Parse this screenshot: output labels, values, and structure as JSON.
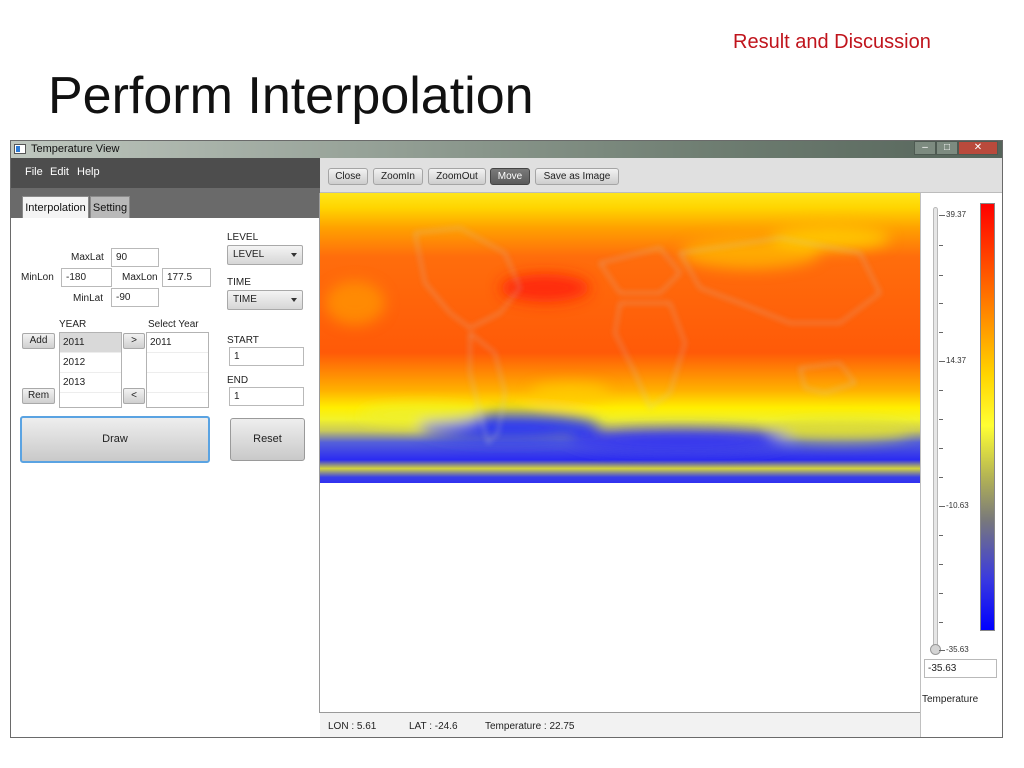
{
  "slide": {
    "section_tag": "Result and Discussion",
    "title": "Perform Interpolation"
  },
  "window": {
    "title": "Temperature View",
    "controls": {
      "minimize": "–",
      "maximize": "□",
      "close": "✕"
    }
  },
  "menu": [
    "File",
    "Edit",
    "Help"
  ],
  "tabs": [
    "Interpolation",
    "Setting"
  ],
  "bounds": {
    "maxlat_label": "MaxLat",
    "maxlat": "90",
    "minlon_label": "MinLon",
    "minlon": "-180",
    "maxlon_label": "MaxLon",
    "maxlon": "177.5",
    "minlat_label": "MinLat",
    "minlat": "-90"
  },
  "level": {
    "label": "LEVEL",
    "value": "LEVEL"
  },
  "time": {
    "label": "TIME",
    "value": "TIME"
  },
  "years": {
    "year_label": "YEAR",
    "select_label": "Select Year",
    "available": [
      "2011",
      "2012",
      "2013"
    ],
    "selected": [
      "2011"
    ],
    "add": "Add",
    "rem": "Rem",
    "move_right": ">",
    "move_left": "<"
  },
  "start": {
    "label": "START",
    "value": "1"
  },
  "end": {
    "label": "END",
    "value": "1"
  },
  "buttons": {
    "draw": "Draw",
    "reset": "Reset"
  },
  "toolbar": [
    "Close",
    "ZoomIn",
    "ZoomOut",
    "Move",
    "Save as Image"
  ],
  "toolbar_active": "Move",
  "status": {
    "lon": "LON : 5.61",
    "lat": "LAT : -24.6",
    "temperature": "Temperature : 22.75"
  },
  "legend": {
    "ticks": [
      "39.37",
      "14.37",
      "-10.63",
      "-35.63"
    ],
    "min_value": "-35.63",
    "caption": "Temperature",
    "colors": {
      "max": "#ff0000",
      "mid": "#ffff33",
      "min": "#0000ff"
    }
  }
}
